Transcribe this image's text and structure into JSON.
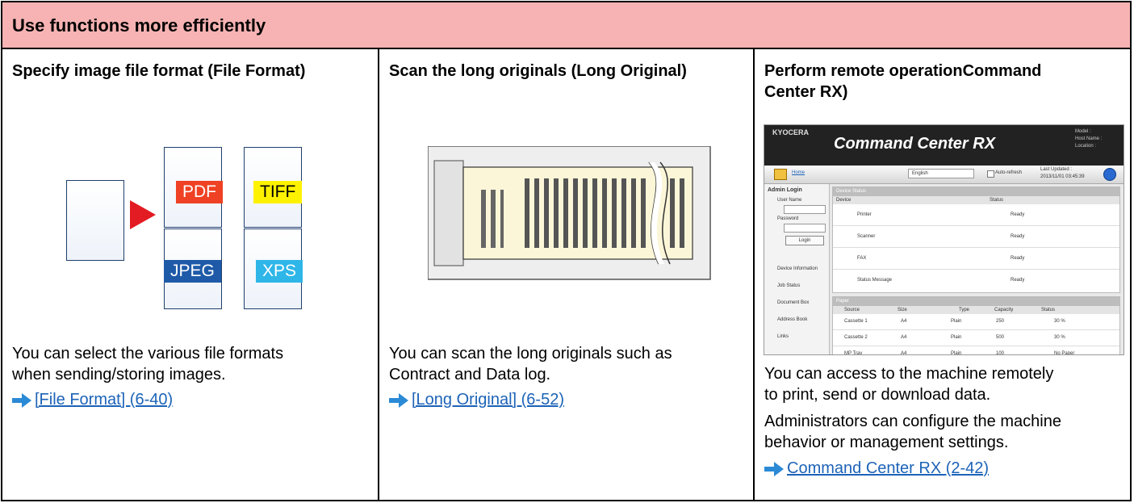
{
  "header": {
    "title": "Use functions more efficiently"
  },
  "columns": [
    {
      "title": "Specify image file format (File Format)",
      "description": [
        "You can select the various file formats",
        "when sending/storing images."
      ],
      "link": "[File Format] (6-40)",
      "formats": [
        "PDF",
        "TIFF",
        "JPEG",
        "XPS"
      ]
    },
    {
      "title": "Scan the long originals (Long Original)",
      "description": [
        "You can scan the long originals such as",
        "Contract and Data log."
      ],
      "link": "[Long Original] (6-52)"
    },
    {
      "title_lines": [
        "Perform remote operationCommand",
        "Center RX)"
      ],
      "description": [
        "You can access to the machine remotely",
        "to print, send or download data.",
        "Administrators can configure the machine",
        "behavior or management settings."
      ],
      "link": "Command Center RX (2-42)",
      "screenshot": {
        "brand": "KYOCERA",
        "app_title": "Command Center RX",
        "header_info": [
          "Model :",
          "Host Name :",
          "Location :"
        ],
        "home": "Home",
        "language": "English",
        "auto_refresh": "Auto-refresh",
        "last_updated_label": "Last Updated :",
        "last_updated": "2013/11/01 03:45:39",
        "login": {
          "title": "Admin Login",
          "user_label": "User Name",
          "password_label": "Password",
          "button": "Login"
        },
        "nav": [
          "Device Information",
          "Job Status",
          "Document Box",
          "Address Book",
          "Links"
        ],
        "device_status": {
          "section": "Device Status",
          "headers": [
            "Device",
            "Status"
          ],
          "rows": [
            {
              "device": "Printer",
              "status": "Ready"
            },
            {
              "device": "Scanner",
              "status": "Ready"
            },
            {
              "device": "FAX",
              "status": "Ready"
            },
            {
              "device": "Status Message",
              "status": "Ready"
            }
          ]
        },
        "paper": {
          "section": "Paper",
          "headers": [
            "Source",
            "Size",
            "Type",
            "Capacity",
            "Status"
          ],
          "rows": [
            {
              "source": "Cassette 1",
              "size": "A4",
              "type": "Plain",
              "capacity": "250",
              "status": "30 %"
            },
            {
              "source": "Cassette 2",
              "size": "A4",
              "type": "Plain",
              "capacity": "500",
              "status": "30 %"
            },
            {
              "source": "MP Tray",
              "size": "A4",
              "type": "Plain",
              "capacity": "100",
              "status": "No Paper"
            }
          ]
        }
      }
    }
  ],
  "colors": {
    "header_bg": "#f7b3b3",
    "link": "#1d63b8",
    "pdf": "#ef4123",
    "tiff": "#fff200",
    "jpeg": "#1e5aa8",
    "xps": "#2eb6e8",
    "play_arrow": "#e31b23",
    "long_paper": "#fbf6d8"
  }
}
